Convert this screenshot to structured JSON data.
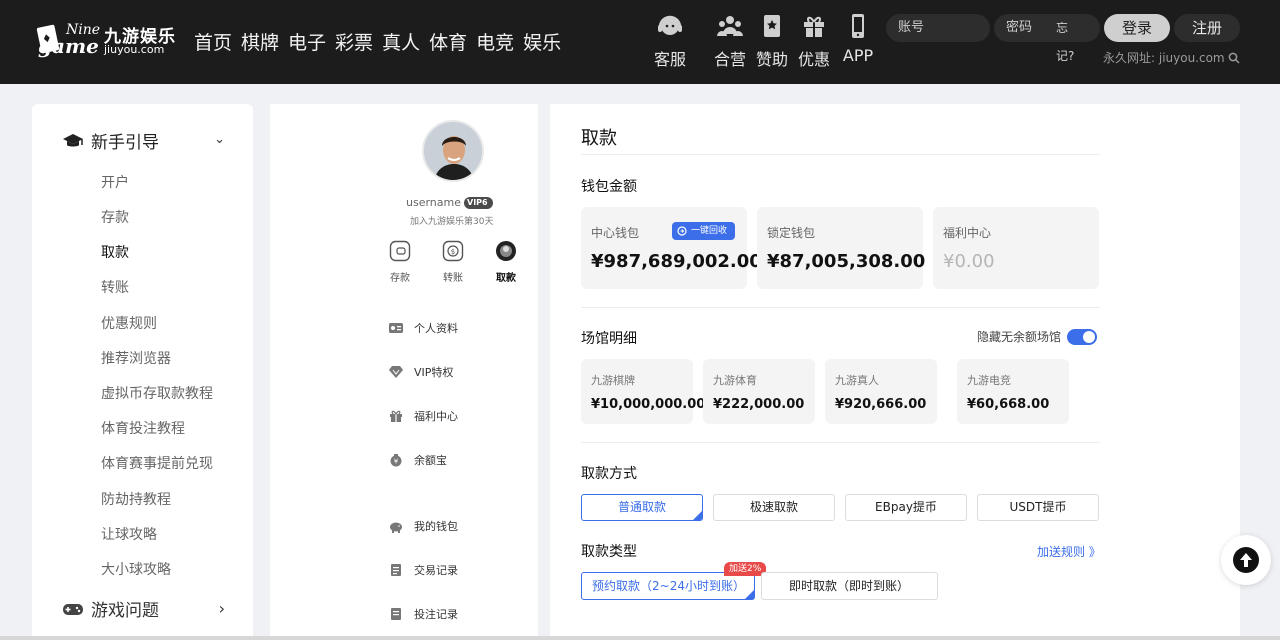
{
  "header": {
    "logo": {
      "en_top": "Nine",
      "en_bottom": "game",
      "cn": "九游娱乐",
      "domain": "jiuyou.com"
    },
    "nav": [
      "首页",
      "棋牌",
      "电子",
      "彩票",
      "真人",
      "体育",
      "电竞",
      "娱乐"
    ],
    "quick_links": [
      {
        "label": "客服",
        "icon": "headset-icon"
      },
      {
        "label": "合营",
        "icon": "partners-icon"
      },
      {
        "label": "赞助",
        "icon": "sponsor-icon"
      },
      {
        "label": "优惠",
        "icon": "gift-icon"
      },
      {
        "label": "APP",
        "icon": "phone-icon"
      }
    ],
    "login": {
      "username_placeholder": "账号",
      "password_placeholder": "密码",
      "forgot": "忘记?",
      "login_button": "登录",
      "register_button": "注册"
    },
    "permanent_url": "永久网址: jiuyou.com"
  },
  "sidebar": {
    "group_guide": "新手引导",
    "items": [
      "开户",
      "存款",
      "取款",
      "转账",
      "优惠规则",
      "推荐浏览器",
      "虚拟币存取款教程",
      "体育投注教程",
      "体育赛事提前兑现",
      "防劫持教程",
      "让球攻略",
      "大小球攻略"
    ],
    "active_item": "取款",
    "group_games": "游戏问题"
  },
  "profile": {
    "username": "username",
    "vip": "VIP6",
    "joined": "加入九游娱乐第30天",
    "wallet_actions": [
      "存款",
      "转账",
      "取款"
    ],
    "menu": [
      "个人资料",
      "VIP特权",
      "福利中心",
      "余额宝",
      "我的钱包",
      "交易记录",
      "投注记录"
    ]
  },
  "main": {
    "title": "取款",
    "wallet_section": "钱包金额",
    "wallets": [
      {
        "label": "中心钱包",
        "amount": "¥987,689,002.00"
      },
      {
        "label": "锁定钱包",
        "amount": "¥87,005,308.00"
      },
      {
        "label": "福利中心",
        "amount": "¥0.00"
      }
    ],
    "reclaim_button": "一键回收",
    "venue_section": "场馆明细",
    "hide_empty_label": "隐藏无余额场馆",
    "hide_empty_enabled": true,
    "venues": [
      {
        "label": "九游棋牌",
        "amount": "¥10,000,000.00"
      },
      {
        "label": "九游体育",
        "amount": "¥222,000.00"
      },
      {
        "label": "九游真人",
        "amount": "¥920,666.00"
      },
      {
        "label": "九游电竞",
        "amount": "¥60,668.00"
      }
    ],
    "method_section": "取款方式",
    "methods": [
      "普通取款",
      "极速取款",
      "EBpay提币",
      "USDT提币"
    ],
    "active_method": "普通取款",
    "type_section": "取款类型",
    "rules_link": "加送规则 》",
    "types": [
      "预约取款（2~24小时到账）",
      "即时取款（即时到账）"
    ],
    "speed_badge": "加送2%"
  },
  "colors": {
    "accent": "#3b6ee8",
    "header_bg": "#1c1c1c",
    "badge_red": "#e84a4a"
  }
}
